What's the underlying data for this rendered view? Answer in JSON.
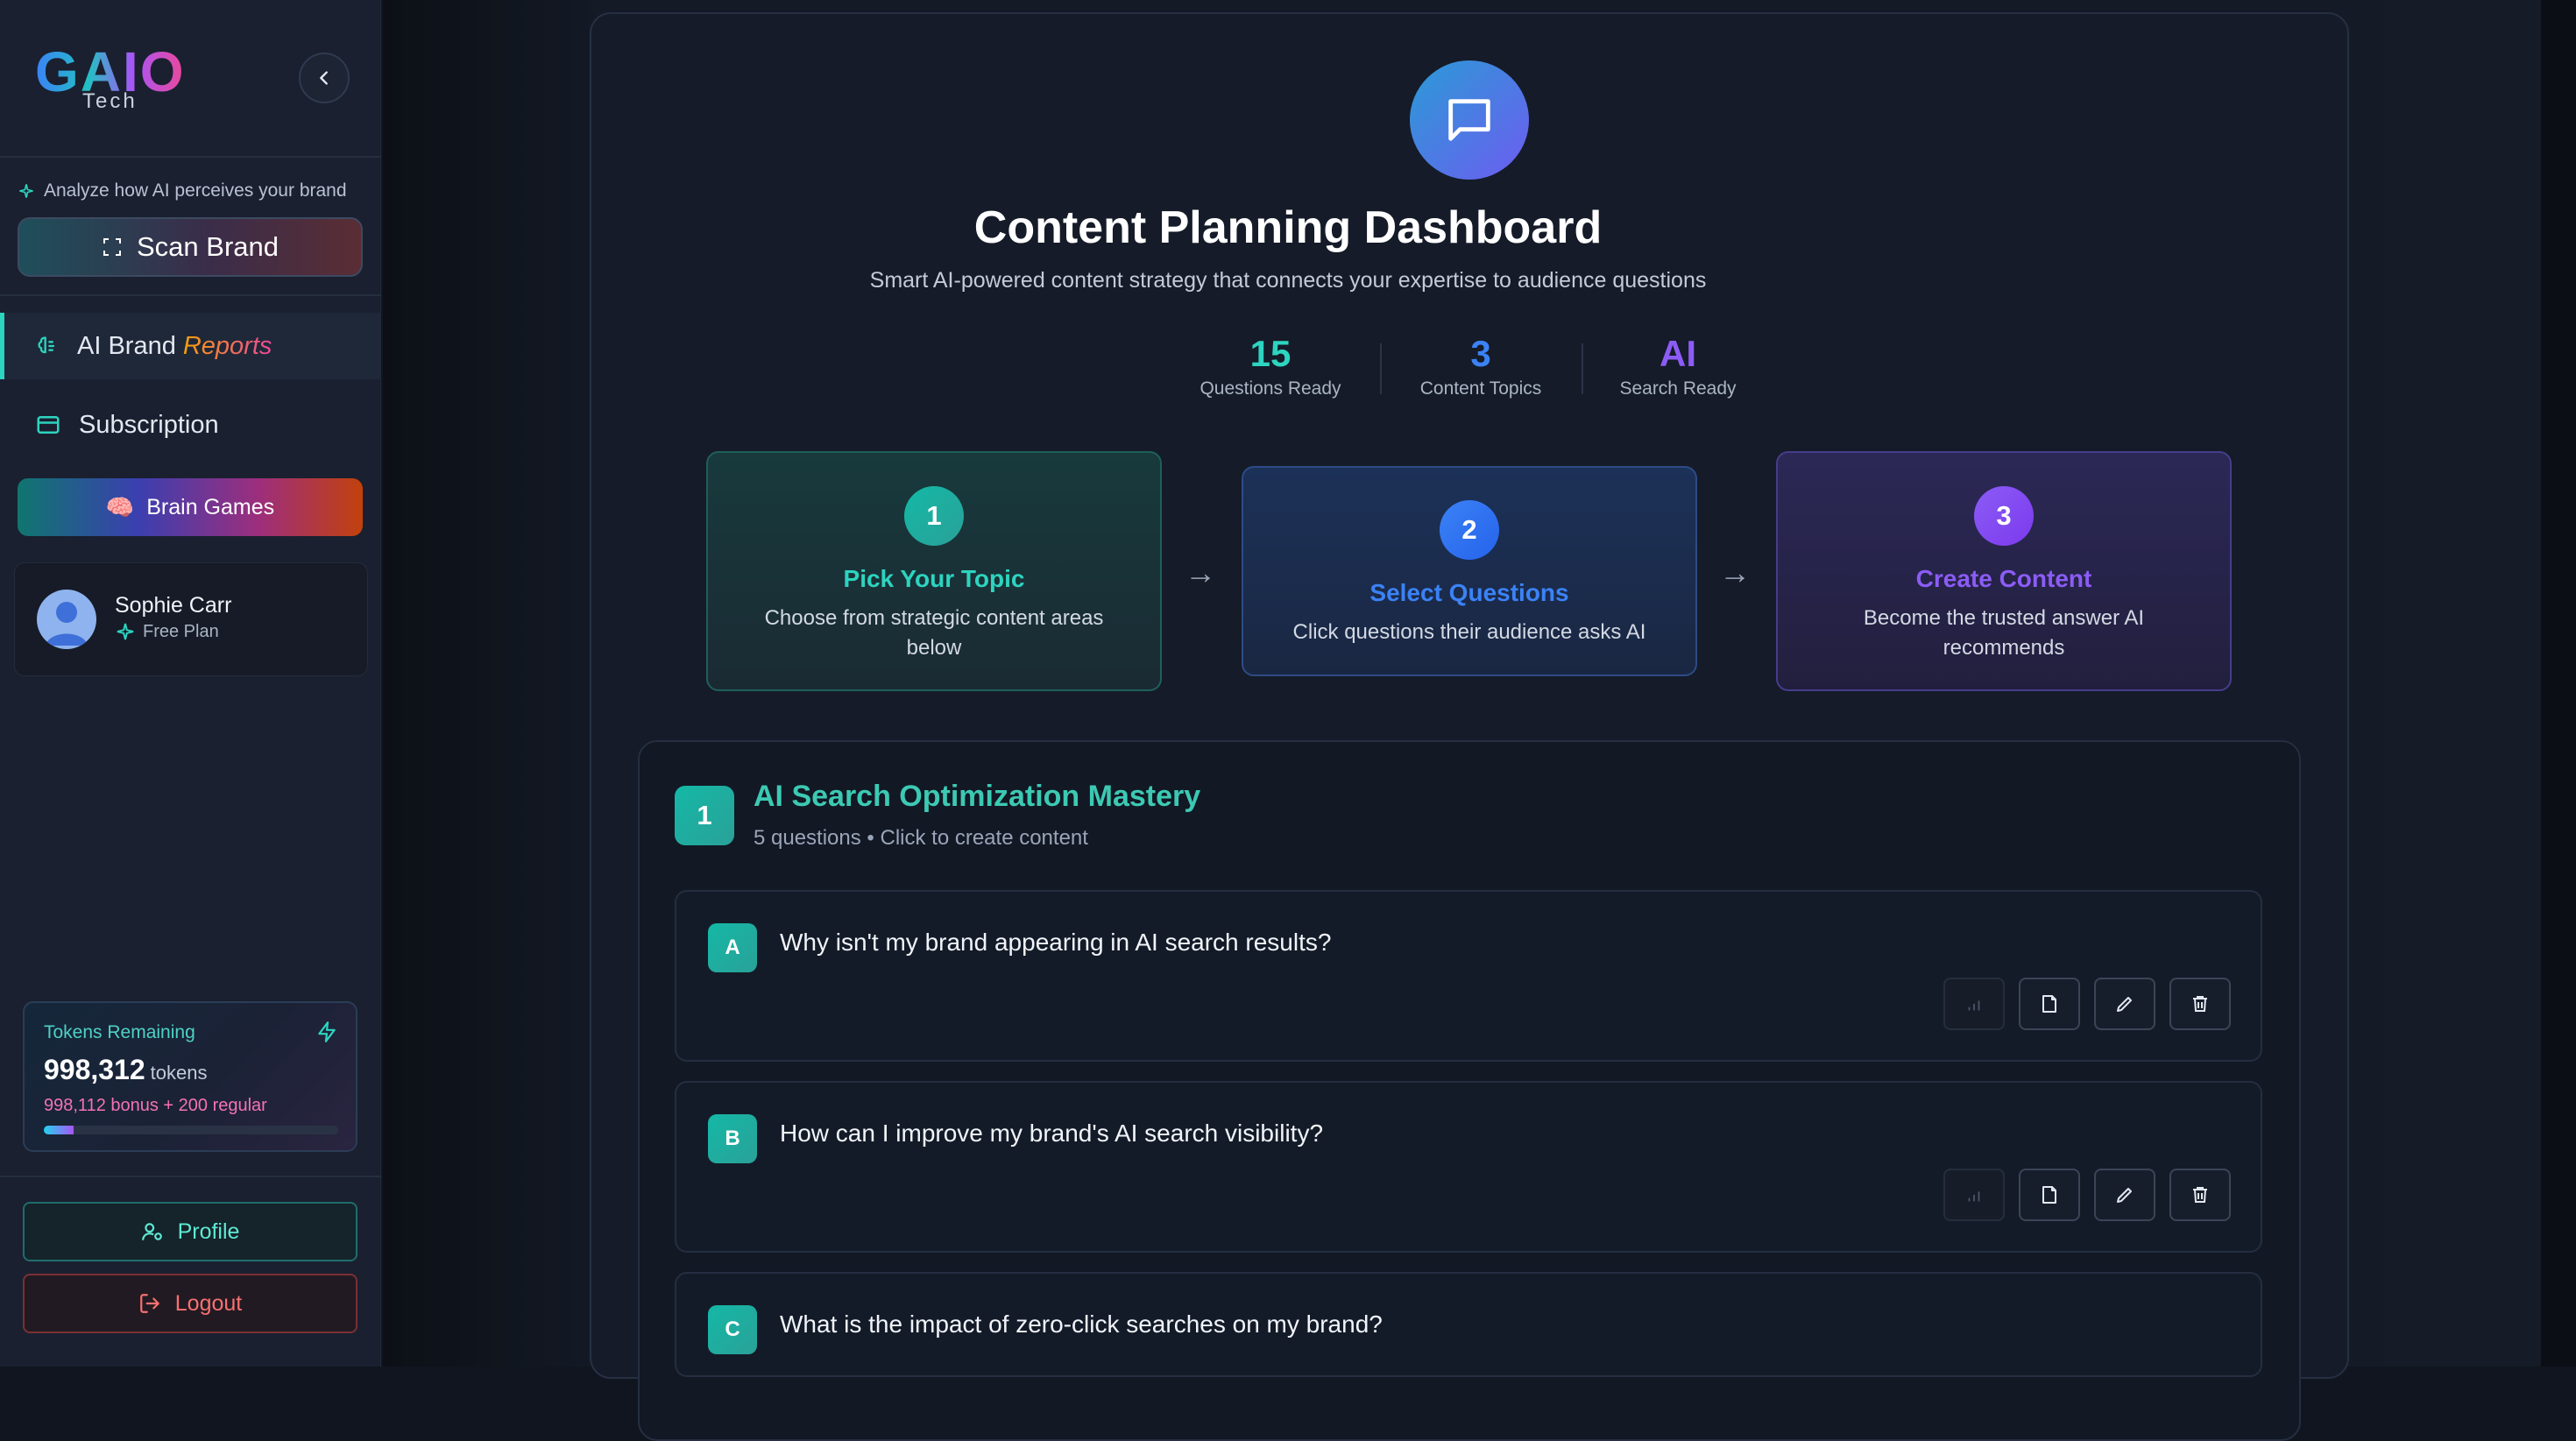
{
  "sidebar": {
    "logo_main": "GAIO",
    "logo_sub": "Tech",
    "analyze_text": "Analyze how AI perceives your brand",
    "scan_button": "Scan Brand",
    "nav": {
      "reports_prefix": "AI Brand",
      "reports_accent": "Reports",
      "subscription": "Subscription"
    },
    "brain_games": "Brain Games",
    "user": {
      "name": "Sophie Carr",
      "plan": "Free Plan"
    },
    "tokens": {
      "label": "Tokens Remaining",
      "value": "998,312",
      "unit": "tokens",
      "breakdown": "998,112 bonus + 200 regular",
      "progress_percent": 10
    },
    "profile_button": "Profile",
    "logout_button": "Logout"
  },
  "header": {
    "title": "Content Planning Dashboard",
    "subtitle": "Smart AI-powered content strategy that connects your expertise to audience questions"
  },
  "stats": [
    {
      "value": "15",
      "label": "Questions Ready",
      "color": "#2dd4bf"
    },
    {
      "value": "3",
      "label": "Content Topics",
      "color": "#3b82f6"
    },
    {
      "value": "AI",
      "label": "Search Ready",
      "color": "#8b5cf6"
    }
  ],
  "steps": [
    {
      "num": "1",
      "title": "Pick Your Topic",
      "desc": "Choose from strategic content areas below",
      "color": "#2dd4bf"
    },
    {
      "num": "2",
      "title": "Select Questions",
      "desc": "Click questions their audience asks AI",
      "color": "#3b82f6"
    },
    {
      "num": "3",
      "title": "Create Content",
      "desc": "Become the trusted answer AI recommends",
      "color": "#8b5cf6"
    }
  ],
  "section": {
    "badge": "1",
    "title": "AI Search Optimization Mastery",
    "subtitle": "5 questions • Click to create content",
    "questions": [
      {
        "letter": "A",
        "text": "Why isn't my brand appearing in AI search results?"
      },
      {
        "letter": "B",
        "text": "How can I improve my brand's AI search visibility?"
      },
      {
        "letter": "C",
        "text": "What is the impact of zero-click searches on my brand?"
      }
    ]
  }
}
